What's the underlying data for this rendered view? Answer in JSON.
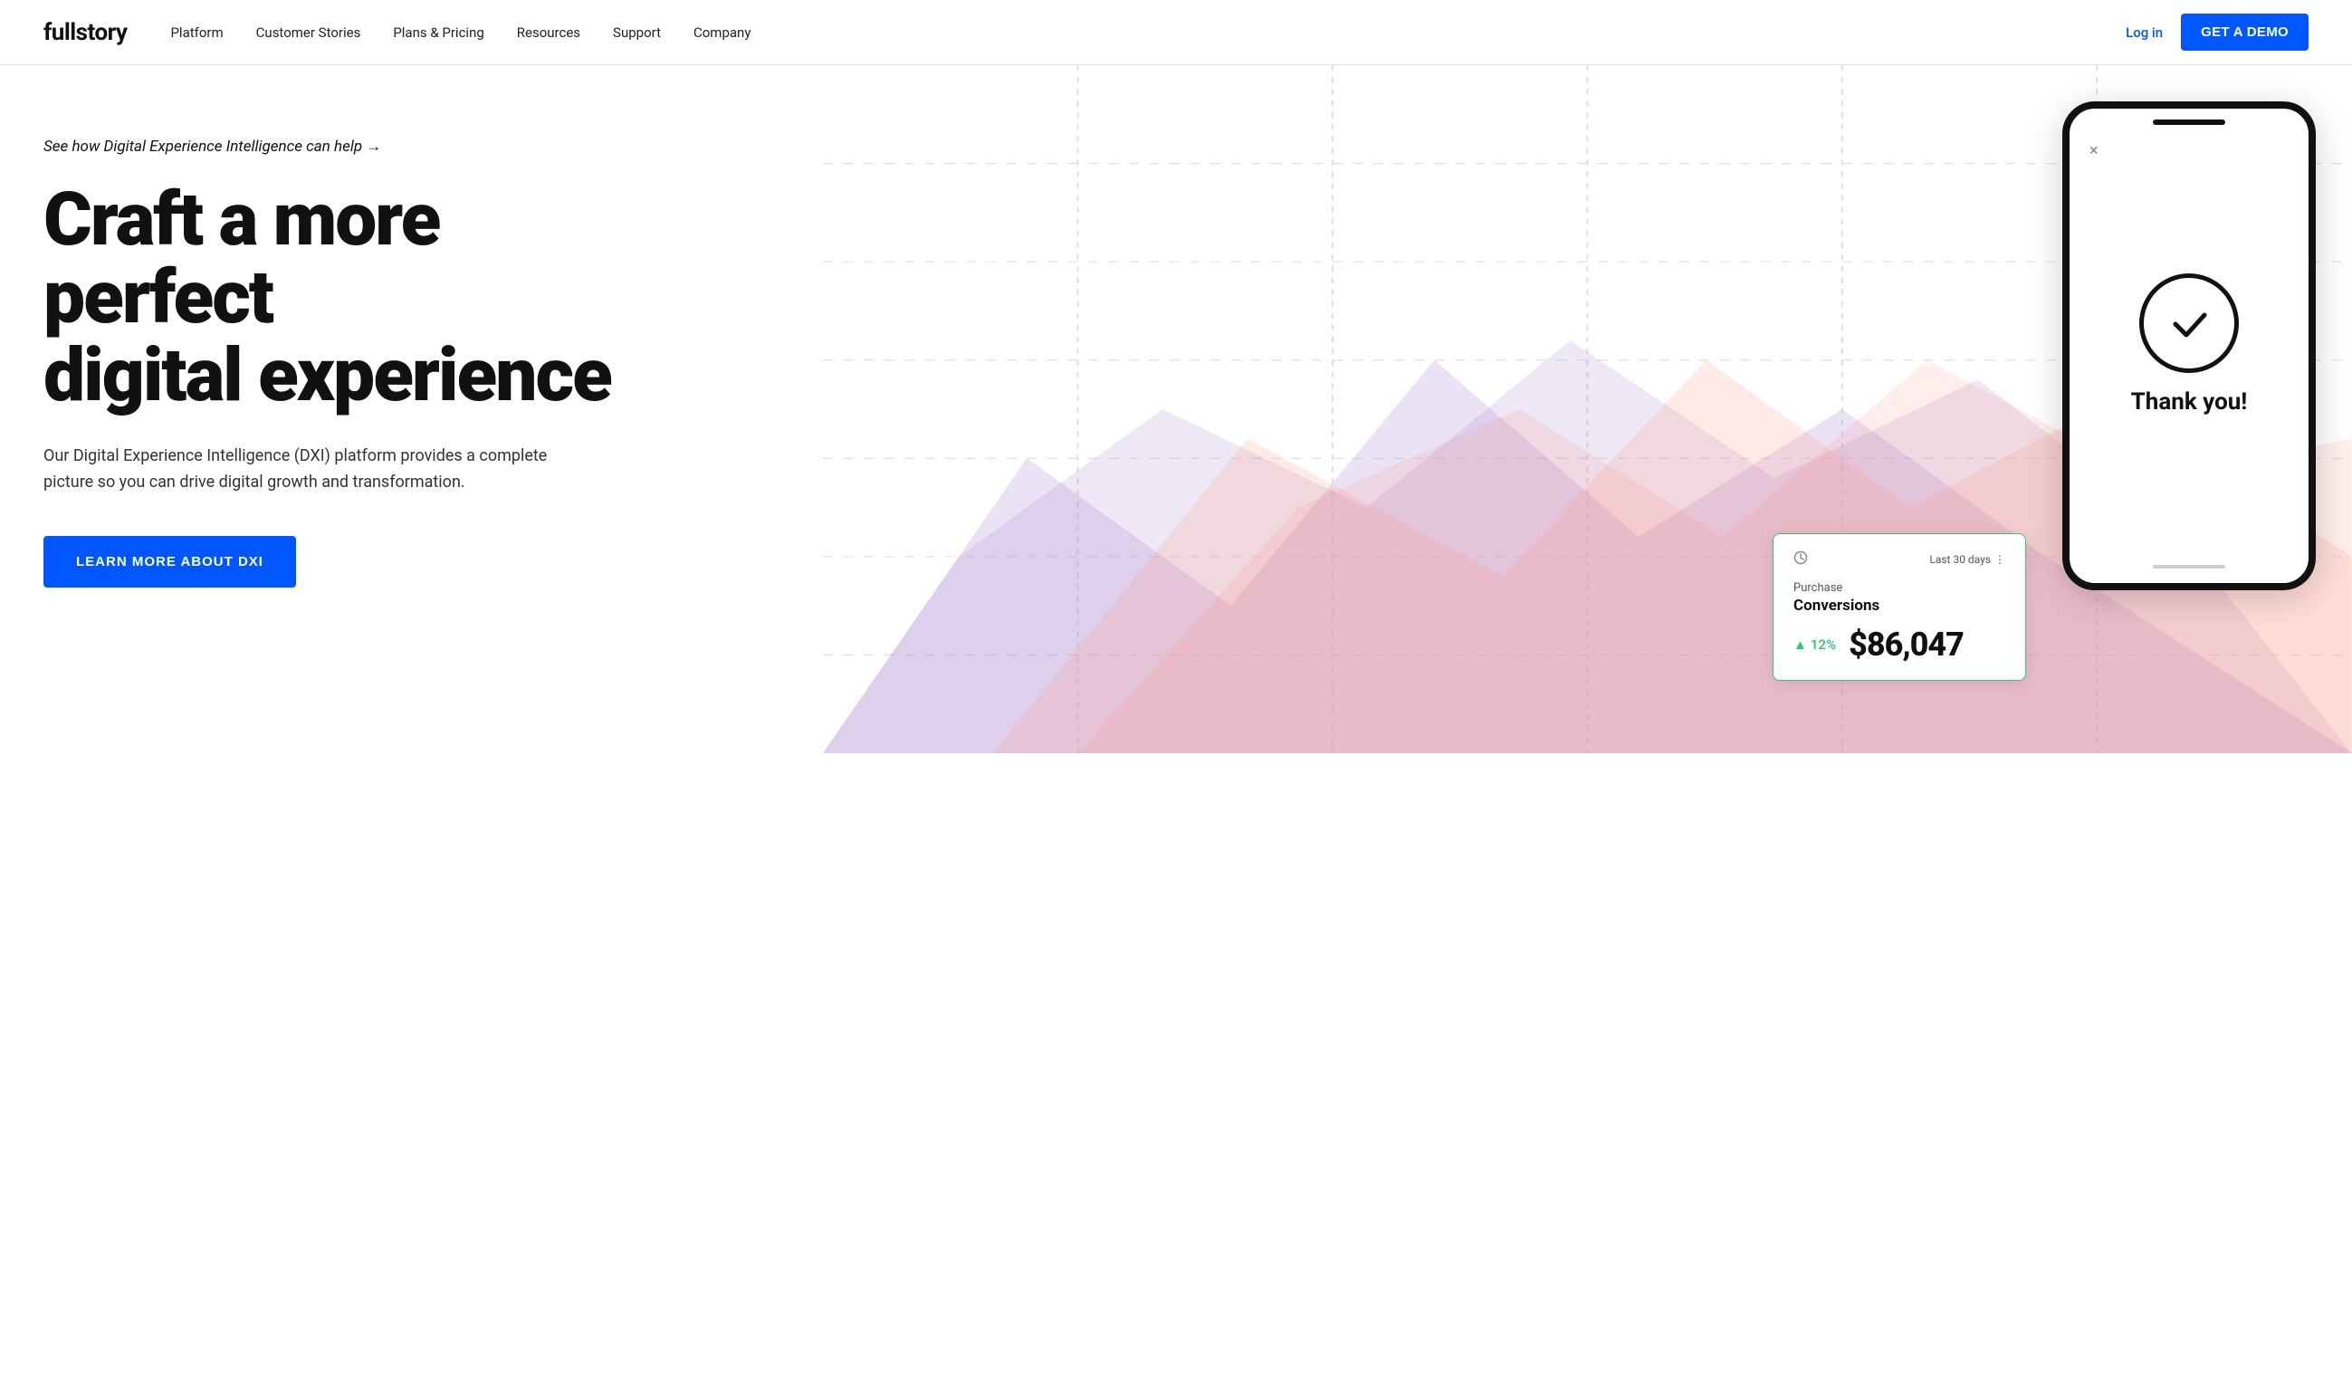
{
  "nav": {
    "logo": "fullstory",
    "links": [
      {
        "label": "Platform",
        "id": "platform"
      },
      {
        "label": "Customer Stories",
        "id": "customer-stories"
      },
      {
        "label": "Plans & Pricing",
        "id": "plans-pricing"
      },
      {
        "label": "Resources",
        "id": "resources"
      },
      {
        "label": "Support",
        "id": "support"
      },
      {
        "label": "Company",
        "id": "company"
      }
    ],
    "login_label": "Log in",
    "demo_label": "GET A DEMO"
  },
  "hero": {
    "tagline": "See how Digital Experience Intelligence can help →",
    "headline_line1": "Craft a more perfect",
    "headline_line2": "digital experience",
    "subtext": "Our Digital Experience Intelligence (DXI) platform provides a complete picture so you can drive digital growth and transformation.",
    "cta_label": "LEARN MORE ABOUT DXI"
  },
  "phone": {
    "thank_you": "Thank you!",
    "close_symbol": "×"
  },
  "conversion_card": {
    "period_label": "Last 30 days",
    "more_symbol": "⋮",
    "metric_label": "Purchase",
    "metric_title": "Conversions",
    "change_percent": "12%",
    "change_arrow": "▲",
    "value": "$86,047"
  },
  "colors": {
    "accent_blue": "#0057ff",
    "green": "#2ecc71",
    "text_dark": "#111111",
    "text_medium": "#333333",
    "text_light": "#888888"
  }
}
